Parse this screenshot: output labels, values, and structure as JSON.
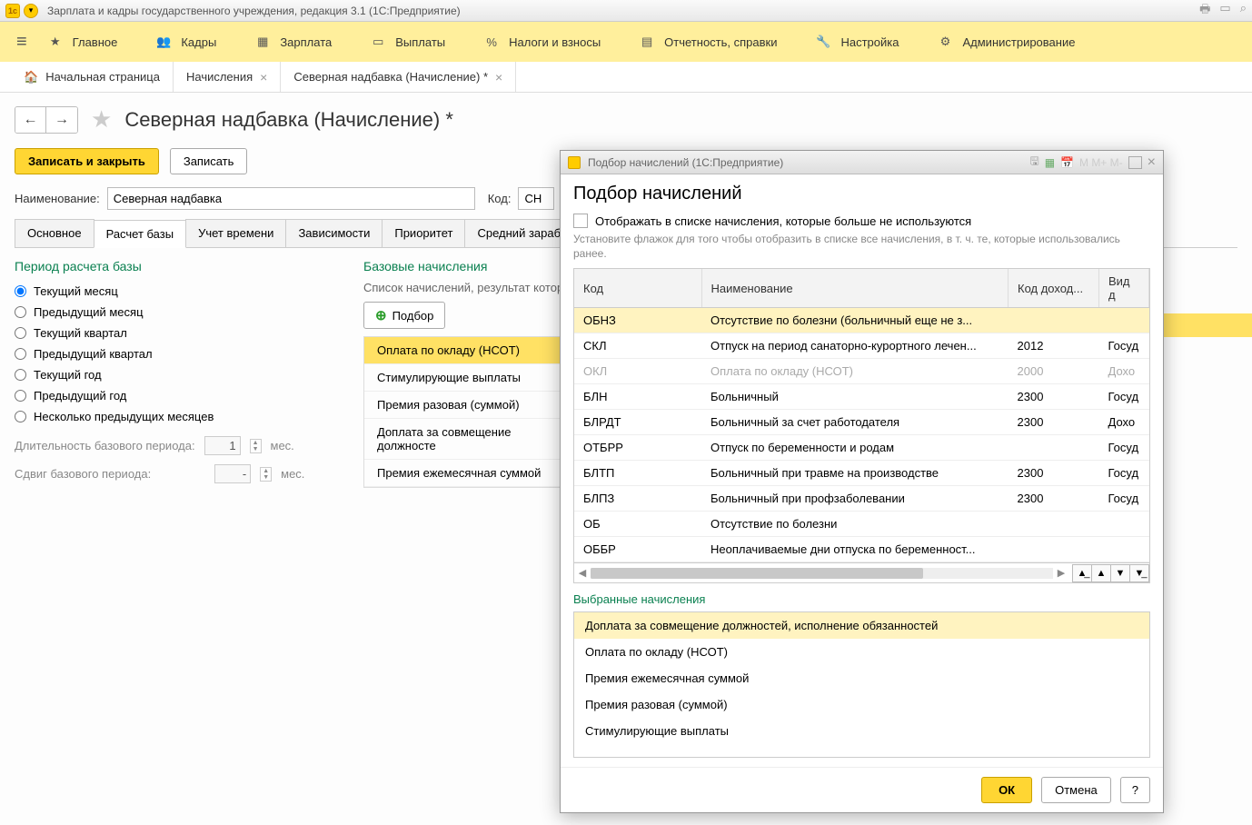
{
  "app": {
    "title": "Зарплата и кадры государственного учреждения, редакция 3.1  (1С:Предприятие)"
  },
  "main_nav": {
    "items": [
      {
        "label": "Главное"
      },
      {
        "label": "Кадры"
      },
      {
        "label": "Зарплата"
      },
      {
        "label": "Выплаты"
      },
      {
        "label": "Налоги и взносы"
      },
      {
        "label": "Отчетность, справки"
      },
      {
        "label": "Настройка"
      },
      {
        "label": "Администрирование"
      }
    ]
  },
  "tabs": {
    "home": "Начальная страница",
    "t1": "Начисления",
    "t2": "Северная надбавка (Начисление) *"
  },
  "doc": {
    "title": "Северная надбавка (Начисление) *",
    "save_close": "Записать и закрыть",
    "save": "Записать",
    "name_label": "Наименование:",
    "name_value": "Северная надбавка",
    "code_label": "Код:",
    "code_value": "СН"
  },
  "form_tabs": [
    "Основное",
    "Расчет базы",
    "Учет времени",
    "Зависимости",
    "Приоритет",
    "Средний заработок"
  ],
  "left": {
    "title": "Период расчета базы",
    "radios": [
      "Текущий месяц",
      "Предыдущий месяц",
      "Текущий квартал",
      "Предыдущий квартал",
      "Текущий год",
      "Предыдущий год",
      "Несколько предыдущих месяцев"
    ],
    "dur_label": "Длительность базового периода:",
    "dur_value": "1",
    "dur_unit": "мес.",
    "shift_label": "Сдвиг базового периода:",
    "shift_value": "-",
    "shift_unit": "мес."
  },
  "right": {
    "title": "Базовые начисления",
    "sub": "Список начислений, результат котор",
    "podbor": "Подбор",
    "items": [
      "Оплата по окладу (НСОТ)",
      "Стимулирующие выплаты",
      "Премия разовая (суммой)",
      "Доплата за совмещение должносте",
      "Премия ежемесячная суммой"
    ]
  },
  "modal": {
    "titlebar": "Подбор начислений  (1С:Предприятие)",
    "h1": "Подбор начислений",
    "chk_label": "Отображать в списке начисления, которые больше не используются",
    "hint": "Установите флажок для того чтобы отобразить в списке все начисления, в т. ч. те, которые использовались ранее.",
    "headers": {
      "code": "Код",
      "name": "Наименование",
      "income": "Код доход...",
      "kind": "Вид д"
    },
    "rows": [
      {
        "code": "ОБНЗ",
        "name": "Отсутствие по болезни (больничный еще не з...",
        "inc": "",
        "kind": "",
        "hl": true
      },
      {
        "code": "СКЛ",
        "name": "Отпуск на период санаторно-курортного лечен...",
        "inc": "2012",
        "kind": "Госуд"
      },
      {
        "code": "ОКЛ",
        "name": "Оплата по окладу (НСОТ)",
        "inc": "2000",
        "kind": "Дохо",
        "disabled": true
      },
      {
        "code": "БЛН",
        "name": "Больничный",
        "inc": "2300",
        "kind": "Госуд"
      },
      {
        "code": "БЛРДТ",
        "name": "Больничный за счет работодателя",
        "inc": "2300",
        "kind": "Дохо"
      },
      {
        "code": "ОТБРР",
        "name": "Отпуск по беременности и родам",
        "inc": "",
        "kind": "Госуд"
      },
      {
        "code": "БЛТП",
        "name": "Больничный при травме на производстве",
        "inc": "2300",
        "kind": "Госуд"
      },
      {
        "code": "БЛПЗ",
        "name": "Больничный при профзаболевании",
        "inc": "2300",
        "kind": "Госуд"
      },
      {
        "code": "ОБ",
        "name": "Отсутствие по болезни",
        "inc": "",
        "kind": ""
      },
      {
        "code": "ОББР",
        "name": "Неоплачиваемые дни отпуска по беременност...",
        "inc": "",
        "kind": ""
      }
    ],
    "selected_title": "Выбранные начисления",
    "selected": [
      {
        "label": "Доплата за совмещение должностей, исполнение обязанностей",
        "hl": true
      },
      {
        "label": "Оплата по окладу (НСОТ)"
      },
      {
        "label": "Премия ежемесячная суммой"
      },
      {
        "label": "Премия разовая (суммой)"
      },
      {
        "label": "Стимулирующие выплаты"
      }
    ],
    "ok": "ОК",
    "cancel": "Отмена",
    "help": "?"
  }
}
